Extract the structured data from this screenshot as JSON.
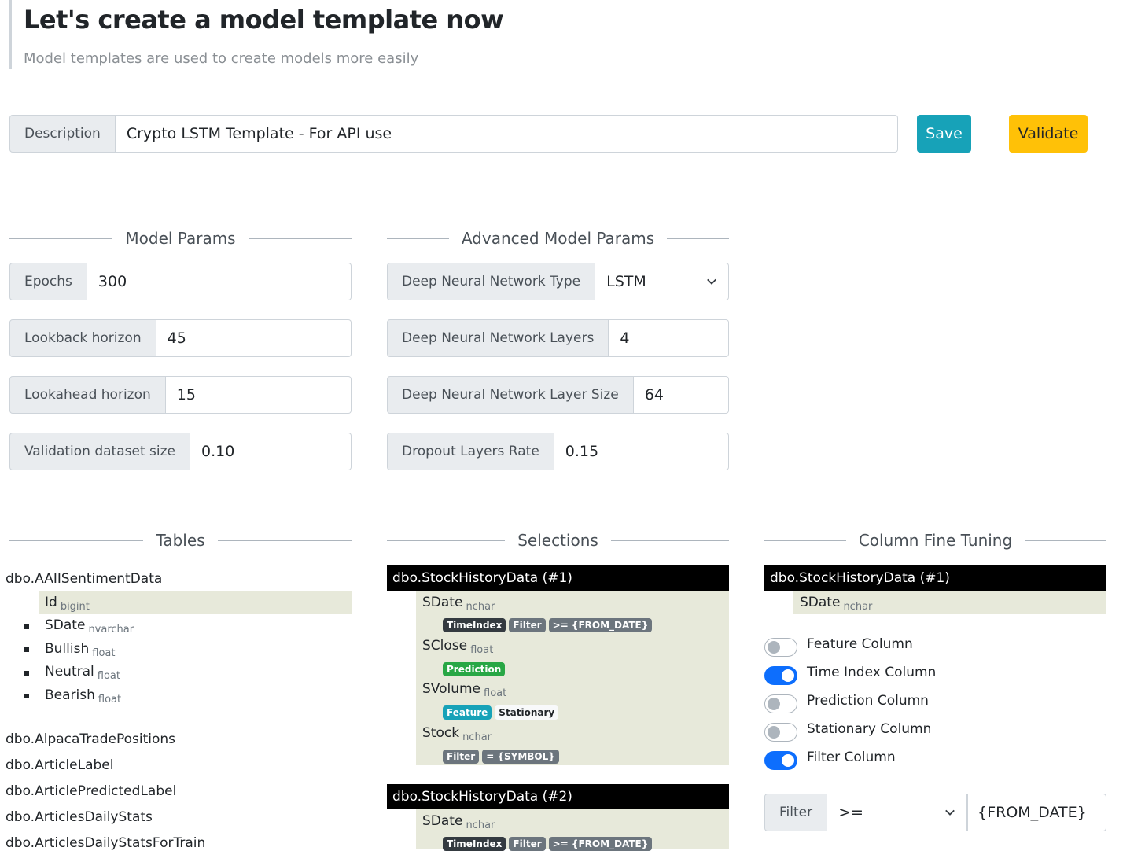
{
  "header": {
    "title": "Let's create a model template now",
    "subtitle": "Model templates are used to create models more easily"
  },
  "description": {
    "label": "Description",
    "value": "Crypto LSTM Template - For API use"
  },
  "buttons": {
    "save": "Save",
    "validate": "Validate"
  },
  "sections": {
    "model_params": "Model Params",
    "advanced_params": "Advanced Model Params",
    "tables": "Tables",
    "selections": "Selections",
    "fine_tuning": "Column Fine Tuning"
  },
  "model_params": [
    {
      "label": "Epochs",
      "value": "300"
    },
    {
      "label": "Lookback horizon",
      "value": "45"
    },
    {
      "label": "Lookahead horizon",
      "value": "15"
    },
    {
      "label": "Validation dataset size",
      "value": "0.10"
    }
  ],
  "advanced_params": [
    {
      "label": "Deep Neural Network Type",
      "value": "LSTM"
    },
    {
      "label": "Deep Neural Network Layers",
      "value": "4"
    },
    {
      "label": "Deep Neural Network Layer Size",
      "value": "64"
    },
    {
      "label": "Dropout Layers Rate",
      "value": "0.15"
    }
  ],
  "tables": {
    "expanded": {
      "name": "dbo.AAIISentimentData",
      "columns": [
        {
          "name": "Id",
          "type": "bigint"
        },
        {
          "name": "SDate",
          "type": "nvarchar"
        },
        {
          "name": "Bullish",
          "type": "float"
        },
        {
          "name": "Neutral",
          "type": "float"
        },
        {
          "name": "Bearish",
          "type": "float"
        }
      ]
    },
    "others": [
      "dbo.AlpacaTradePositions",
      "dbo.ArticleLabel",
      "dbo.ArticlePredictedLabel",
      "dbo.ArticlesDailyStats",
      "dbo.ArticlesDailyStatsForTrain"
    ]
  },
  "selections": [
    {
      "title": "dbo.StockHistoryData (#1)",
      "columns": [
        {
          "name": "SDate",
          "type": "nchar",
          "badges": [
            "TimeIndex",
            "Filter",
            ">= {FROM_DATE}"
          ]
        },
        {
          "name": "SClose",
          "type": "float",
          "badges": [
            "Prediction"
          ]
        },
        {
          "name": "SVolume",
          "type": "float",
          "badges": [
            "Feature",
            "Stationary"
          ]
        },
        {
          "name": "Stock",
          "type": "nchar",
          "badges": [
            "Filter",
            "= {SYMBOL}"
          ]
        }
      ]
    },
    {
      "title": "dbo.StockHistoryData (#2)",
      "columns": [
        {
          "name": "SDate",
          "type": "nchar",
          "badges": [
            "TimeIndex",
            "Filter",
            ">= {FROM_DATE}"
          ]
        }
      ]
    }
  ],
  "fine_tuning": {
    "title": "dbo.StockHistoryData (#1)",
    "column": {
      "name": "SDate",
      "type": "nchar"
    },
    "switches": [
      {
        "label": "Feature Column",
        "on": false
      },
      {
        "label": "Time Index Column",
        "on": true
      },
      {
        "label": "Prediction Column",
        "on": false
      },
      {
        "label": "Stationary Column",
        "on": false
      },
      {
        "label": "Filter Column",
        "on": true
      }
    ],
    "filter": {
      "label": "Filter",
      "operator": ">=",
      "value": "{FROM_DATE}"
    }
  },
  "colors": {
    "save": "#17a2b8",
    "validate": "#ffc107",
    "switch_on": "#0d6efd",
    "pane": "#e7e9da"
  },
  "icons": {
    "select_chevron": "chevron-down-icon"
  }
}
